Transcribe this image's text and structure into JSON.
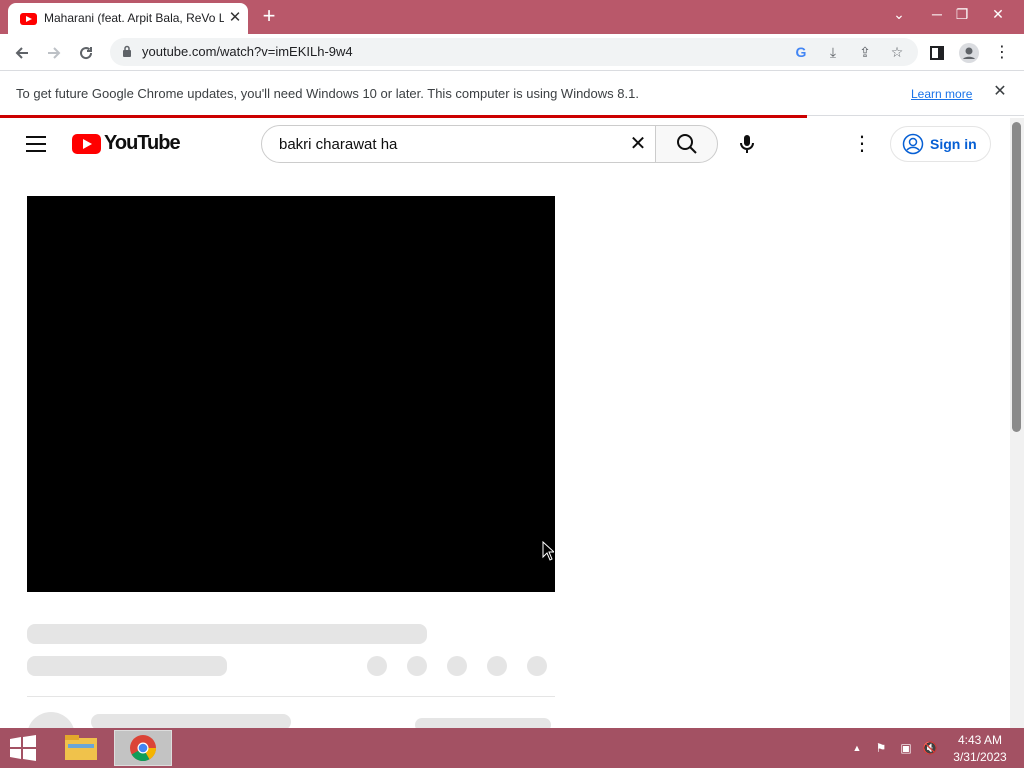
{
  "browser": {
    "tab_title": "Maharani (feat. Arpit Bala, ReVo Lekhak)",
    "tab_close": "✕",
    "new_tab": "+",
    "url": "youtube.com/watch?v=imEKILh-9w4",
    "window_minimize": "─",
    "window_restore": "❐",
    "window_close": "✕",
    "tab_search": "⌄"
  },
  "infobar": {
    "message": "To get future Google Chrome updates, you'll need Windows 10 or later. This computer is using Windows 8.1.",
    "learn_more": "Learn more",
    "close": "✕"
  },
  "youtube": {
    "logo_text": "YouTube",
    "search_query": "bakri charawat ha",
    "sign_in": "Sign in",
    "accent_color": "#ff0000",
    "link_color": "#065fd4"
  },
  "taskbar": {
    "time": "4:43 AM",
    "date": "3/31/2023",
    "tray_arrow": "▲"
  }
}
